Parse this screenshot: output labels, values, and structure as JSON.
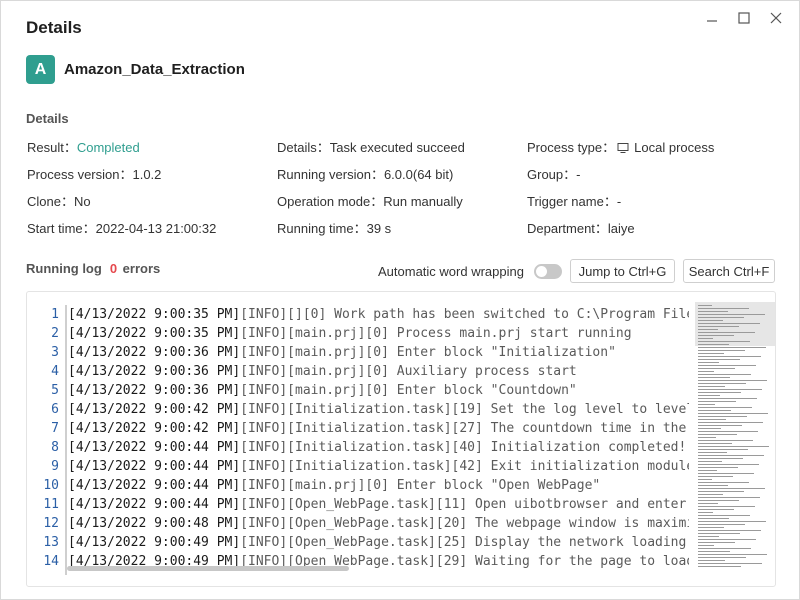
{
  "window": {
    "title": "Details"
  },
  "app": {
    "avatar_letter": "A",
    "name": "Amazon_Data_Extraction",
    "accent_color": "#2f9e8f"
  },
  "details": {
    "section_title": "Details",
    "rows": [
      [
        {
          "label": "Result：",
          "value": "Completed",
          "status": "success"
        },
        {
          "label": "Details：",
          "value": "Task executed succeed"
        },
        {
          "label": "Process type：",
          "value": "Local process",
          "icon": "monitor-icon"
        }
      ],
      [
        {
          "label": "Process version：",
          "value": "1.0.2"
        },
        {
          "label": "Running version：",
          "value": "6.0.0(64 bit)"
        },
        {
          "label": "Group：",
          "value": "-"
        }
      ],
      [
        {
          "label": "Clone：",
          "value": "No"
        },
        {
          "label": "Operation mode：",
          "value": "Run manually"
        },
        {
          "label": "Trigger name：",
          "value": "-"
        }
      ],
      [
        {
          "label": "Start time：",
          "value": "2022-04-13 21:00:32"
        },
        {
          "label": "Running time：",
          "value": "39 s"
        },
        {
          "label": "Department：",
          "value": "laiye"
        }
      ]
    ]
  },
  "log": {
    "title": "Running log",
    "error_count": "0",
    "error_label": "errors",
    "error_color": "#e5484d",
    "word_wrap_label": "Automatic word wrapping",
    "word_wrap_enabled": false,
    "jump_button": "Jump to Ctrl+G",
    "search_button": "Search Ctrl+F",
    "lines": [
      {
        "n": "1",
        "date": "4/13/2022 9:00:35 PM",
        "tag": "[INFO][][0]",
        "msg": " Work path has been switched to C:\\Program Files"
      },
      {
        "n": "2",
        "date": "4/13/2022 9:00:35 PM",
        "tag": "[INFO][main.prj][0]",
        "msg": " Process main.prj start running"
      },
      {
        "n": "3",
        "date": "4/13/2022 9:00:36 PM",
        "tag": "[INFO][main.prj][0]",
        "msg": " Enter block \"Initialization\""
      },
      {
        "n": "4",
        "date": "4/13/2022 9:00:36 PM",
        "tag": "[INFO][main.prj][0]",
        "msg": " Auxiliary process start"
      },
      {
        "n": "5",
        "date": "4/13/2022 9:00:36 PM",
        "tag": "[INFO][main.prj][0]",
        "msg": " Enter block \"Countdown\""
      },
      {
        "n": "6",
        "date": "4/13/2022 9:00:42 PM",
        "tag": "[INFO][Initialization.task][19]",
        "msg": " Set the log level to level"
      },
      {
        "n": "7",
        "date": "4/13/2022 9:00:42 PM",
        "tag": "[INFO][Initialization.task][27]",
        "msg": " The countdown time in the c"
      },
      {
        "n": "8",
        "date": "4/13/2022 9:00:44 PM",
        "tag": "[INFO][Initialization.task][40]",
        "msg": " Initialization completed!"
      },
      {
        "n": "9",
        "date": "4/13/2022 9:00:44 PM",
        "tag": "[INFO][Initialization.task][42]",
        "msg": " Exit initialization module"
      },
      {
        "n": "10",
        "date": "4/13/2022 9:00:44 PM",
        "tag": "[INFO][main.prj][0]",
        "msg": " Enter block \"Open WebPage\""
      },
      {
        "n": "11",
        "date": "4/13/2022 9:00:44 PM",
        "tag": "[INFO][Open_WebPage.task][11]",
        "msg": " Open uibotbrowser and enter t"
      },
      {
        "n": "12",
        "date": "4/13/2022 9:00:48 PM",
        "tag": "[INFO][Open_WebPage.task][20]",
        "msg": " The webpage window is maximiz"
      },
      {
        "n": "13",
        "date": "4/13/2022 9:00:49 PM",
        "tag": "[INFO][Open_WebPage.task][25]",
        "msg": " Display the network loading s"
      },
      {
        "n": "14",
        "date": "4/13/2022 9:00:49 PM",
        "tag": "[INFO][Open_WebPage.task][29]",
        "msg": " Waiting for the page to load"
      }
    ]
  }
}
